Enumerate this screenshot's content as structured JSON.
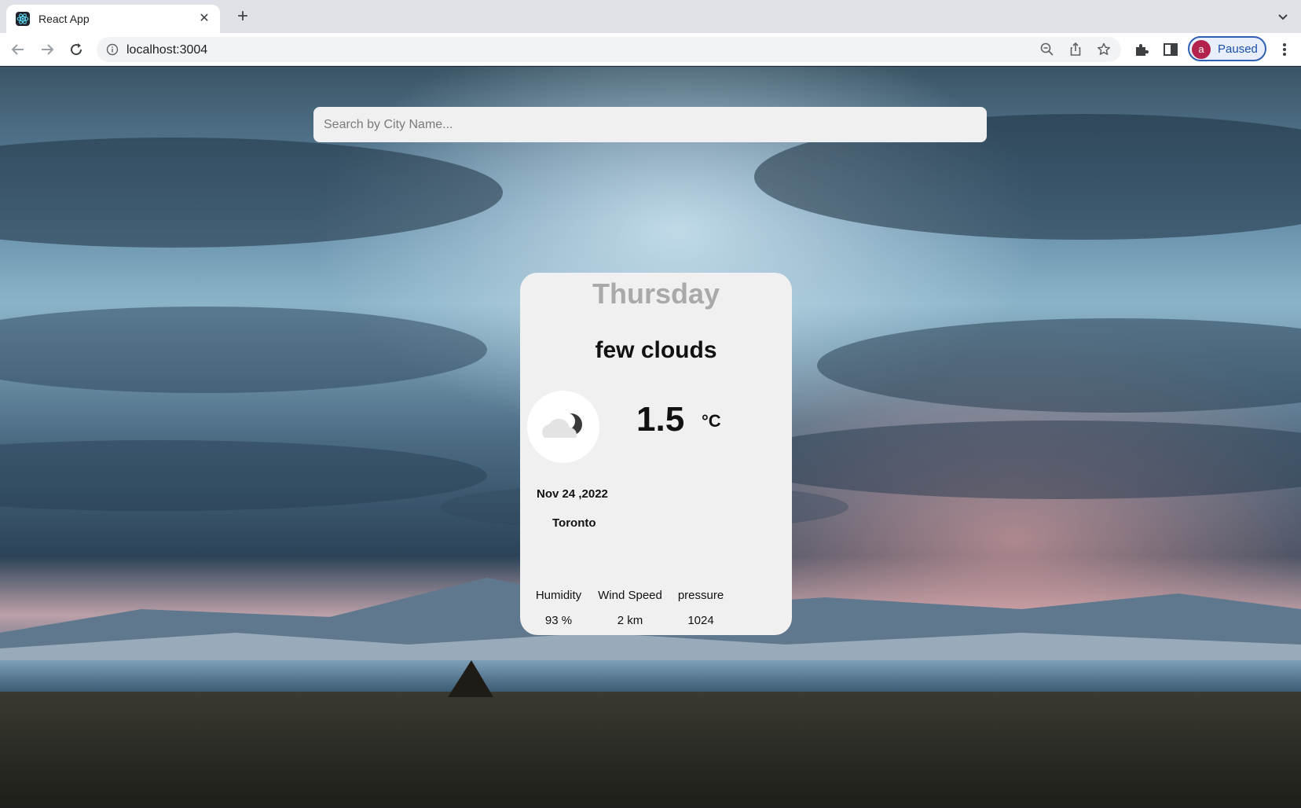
{
  "browser": {
    "tab_title": "React App",
    "url": "localhost:3004",
    "profile_initial": "a",
    "profile_status": "Paused",
    "colors": {
      "profile_avatar": "#b3224d",
      "profile_accent": "#1a4fa8"
    }
  },
  "search": {
    "placeholder": "Search by City Name..."
  },
  "weather": {
    "day": "Thursday",
    "description": "few clouds",
    "icon": "few-clouds-night-icon",
    "temperature": "1.5",
    "unit": "°C",
    "date": "Nov 24 ,2022",
    "city": "Toronto",
    "stats": {
      "humidity_label": "Humidity",
      "humidity_value": "93 %",
      "wind_label": "Wind Speed",
      "wind_value": "2 km",
      "pressure_label": "pressure",
      "pressure_value": "1024"
    }
  }
}
